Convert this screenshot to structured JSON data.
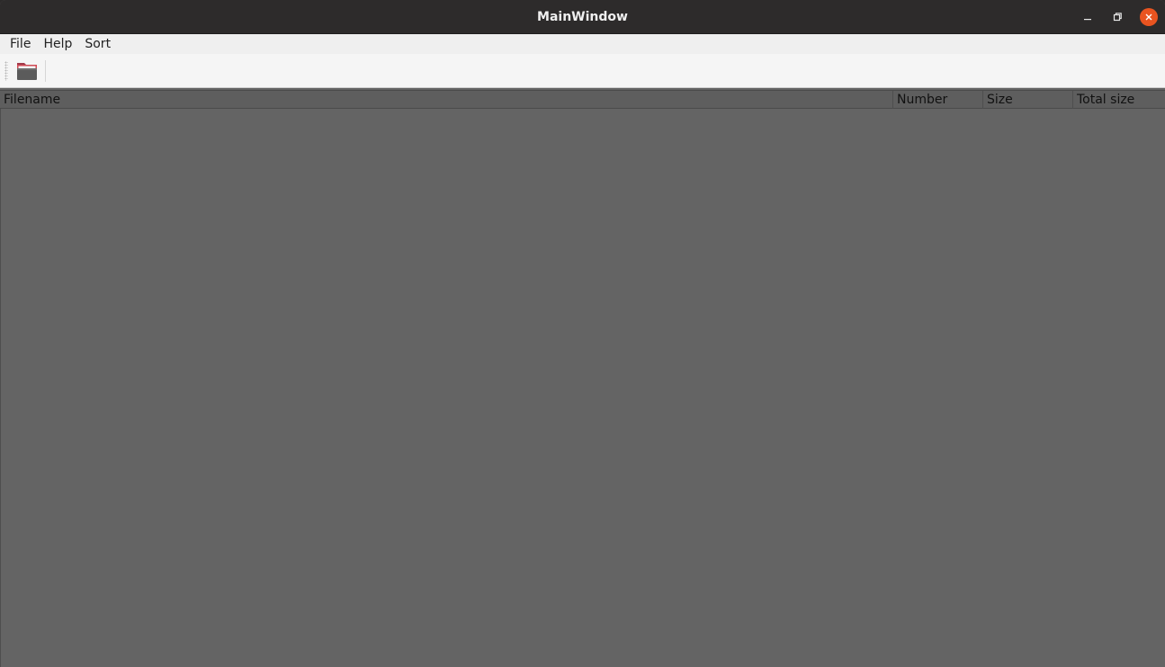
{
  "window": {
    "title": "MainWindow"
  },
  "menu": {
    "items": [
      {
        "label": "File"
      },
      {
        "label": "Help"
      },
      {
        "label": "Sort"
      }
    ]
  },
  "toolbar": {
    "buttons": [
      {
        "icon": "folder-open-icon"
      }
    ]
  },
  "table": {
    "columns": [
      "Filename",
      "Number",
      "Size",
      "Total size"
    ],
    "rows": []
  },
  "colors": {
    "accent": "#e95420",
    "titlebar": "#2d2b2b",
    "table_bg": "#646464"
  }
}
